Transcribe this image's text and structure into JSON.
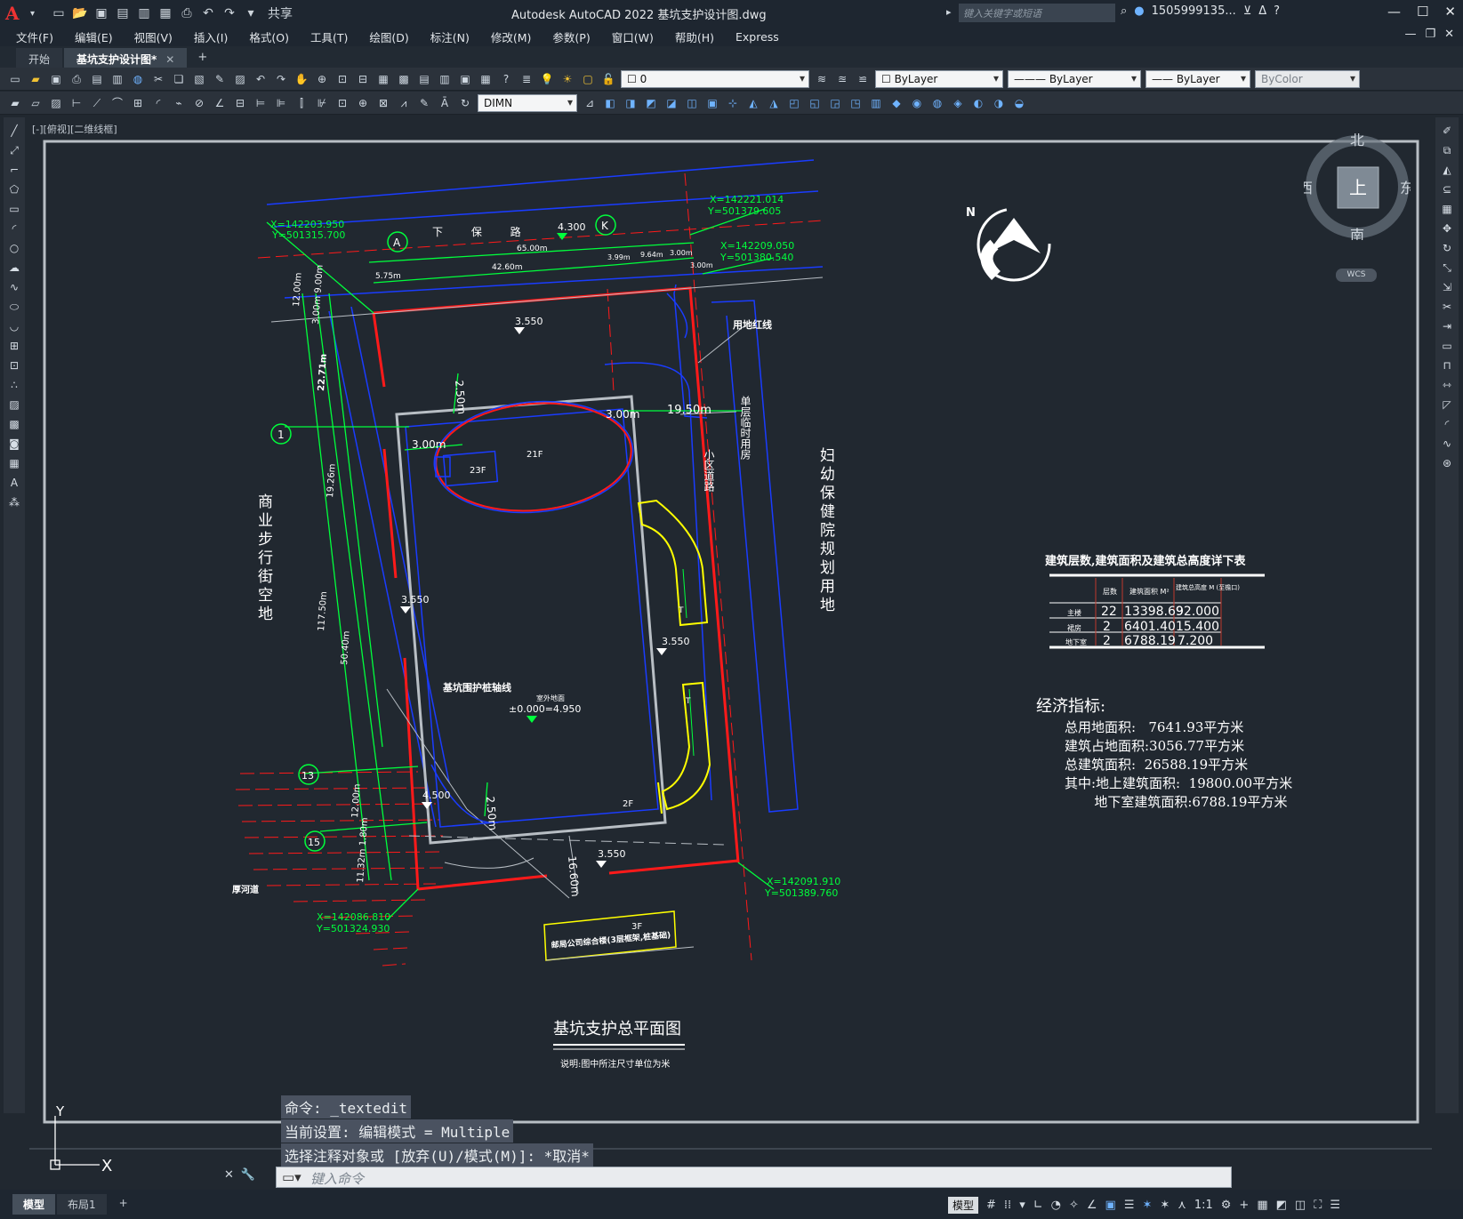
{
  "titlebar": {
    "logo": "A",
    "share": "共享",
    "title": "Autodesk AutoCAD 2022    基坑支护设计图.dwg",
    "search_placeholder": "键入关键字或短语",
    "user": "1505999135...",
    "help": "?"
  },
  "menubar": {
    "items": [
      "文件(F)",
      "编辑(E)",
      "视图(V)",
      "插入(I)",
      "格式(O)",
      "工具(T)",
      "绘图(D)",
      "标注(N)",
      "修改(M)",
      "参数(P)",
      "窗口(W)",
      "帮助(H)",
      "Express"
    ]
  },
  "tabs": {
    "items": [
      {
        "label": "开始"
      },
      {
        "label": "基坑支护设计图*"
      }
    ],
    "plus": "+"
  },
  "toolbar1": {
    "layer_value": "0",
    "color_value": "ByLayer",
    "linetype_value": "ByLayer",
    "lineweight_value": "ByLayer",
    "plotstyle_value": "ByColor"
  },
  "toolbar2": {
    "dimstyle_value": "DIMN"
  },
  "viewport": {
    "label": "[-][俯视][二维线框]"
  },
  "compass": {
    "north": "北",
    "south": "南",
    "east": "东",
    "west": "西",
    "top": "上",
    "wcs": "WCS"
  },
  "drawing": {
    "north_arrow": "N",
    "axis_A": "A",
    "axis_K": "K",
    "axis_1": "1",
    "axis_13": "13",
    "axis_15": "15",
    "road_top": "下  保  路",
    "elev_top": "4.300",
    "coord_tl": "X=142203.950",
    "coord_tl2": "Y=501315.700",
    "coord_tr": "X=142221.014",
    "coord_tr2": "Y=501379.605",
    "coord_r": "X=142209.050",
    "coord_r2": "Y=501380.540",
    "coord_br": "X=142091.910",
    "coord_br2": "Y=501389.760",
    "coord_bl": "X=142086.810",
    "coord_bl2": "Y=501324.930",
    "dim_65": "65.00m",
    "dim_4260": "42.60m",
    "dim_575": "5.75m",
    "dim_399": "3.99m",
    "dim_964": "9.64m",
    "dim_300a": "3.00m",
    "dim_300b": "3.00m",
    "dim_1200": "12.00m",
    "dim_900": "3.00m 9.00m",
    "dim_2271": "22.71m",
    "dim_1926": "19.26m",
    "dim_11750": "117.50m",
    "dim_5040": "50.40m",
    "dim_1200b": "12.00m",
    "dim_1132": "11.32m 1.80m",
    "dim_250a": "2.50m",
    "dim_300c": "3.00m",
    "dim_1950": "19.50m",
    "dim_300d": "3.00m",
    "dim_250b": "2.50m",
    "dim_1660": "16.60m",
    "elev_3550a": "3.550",
    "elev_3550b": "3.550",
    "elev_3550c": "3.550",
    "elev_3550d": "3.550",
    "elev_4500": "4.500",
    "label_redline": "用地红线",
    "label_temp": "单层临时用房",
    "label_road": "小区道路",
    "label_hospital": "妇幼保健院规划用地",
    "label_street": "商业步行街空地",
    "label_pitline": "基坑围护桩轴线",
    "label_elev_main": "±0.000=4.950",
    "label_indoor": "室外地面",
    "label_river": "厚河道",
    "label_21f": "21F",
    "label_23f": "23F",
    "label_2f": "2F",
    "label_3f": "3F",
    "label_office": "邮局公司综合楼(3层框架,桩基础)",
    "label_t1": "T",
    "label_t2": "T"
  },
  "table": {
    "title": "建筑层数,建筑面积及建筑总高度详下表",
    "headers": [
      "",
      "层数",
      "建筑面积 M²",
      "建筑总高度 M (至檐口)"
    ],
    "rows": [
      [
        "主楼",
        "22",
        "13398.69",
        "92.000"
      ],
      [
        "裙房",
        "2",
        "6401.40",
        "15.400"
      ],
      [
        "地下室",
        "2",
        "6788.19",
        "7.200"
      ]
    ]
  },
  "econ": {
    "heading": "经济指标:",
    "rows": [
      "总用地面积:   7641.93平方米",
      "建筑占地面积:3056.77平方米",
      "总建筑面积:  26588.19平方米",
      "其中:地上建筑面积:  19800.00平方米",
      "       地下室建筑面积:6788.19平方米"
    ]
  },
  "plan": {
    "title": "基坑支护总平面图",
    "note": "说明:图中所注尺寸单位为米"
  },
  "ucs": {
    "y": "Y",
    "x": "X"
  },
  "command": {
    "history": [
      "命令: _textedit",
      "当前设置: 编辑模式 = Multiple",
      "选择注释对象或 [放弃(U)/模式(M)]: *取消*"
    ],
    "placeholder": "键入命令"
  },
  "statusbar": {
    "layouts": [
      "模型",
      "布局1"
    ],
    "plus": "+",
    "model": "模型",
    "scale": "1:1"
  },
  "colors": {
    "bg": "#212830",
    "green": "#00ff3c",
    "red": "#ff1a1a",
    "blue": "#1a3cff",
    "yellow": "#ffff00",
    "white": "#ffffff"
  }
}
